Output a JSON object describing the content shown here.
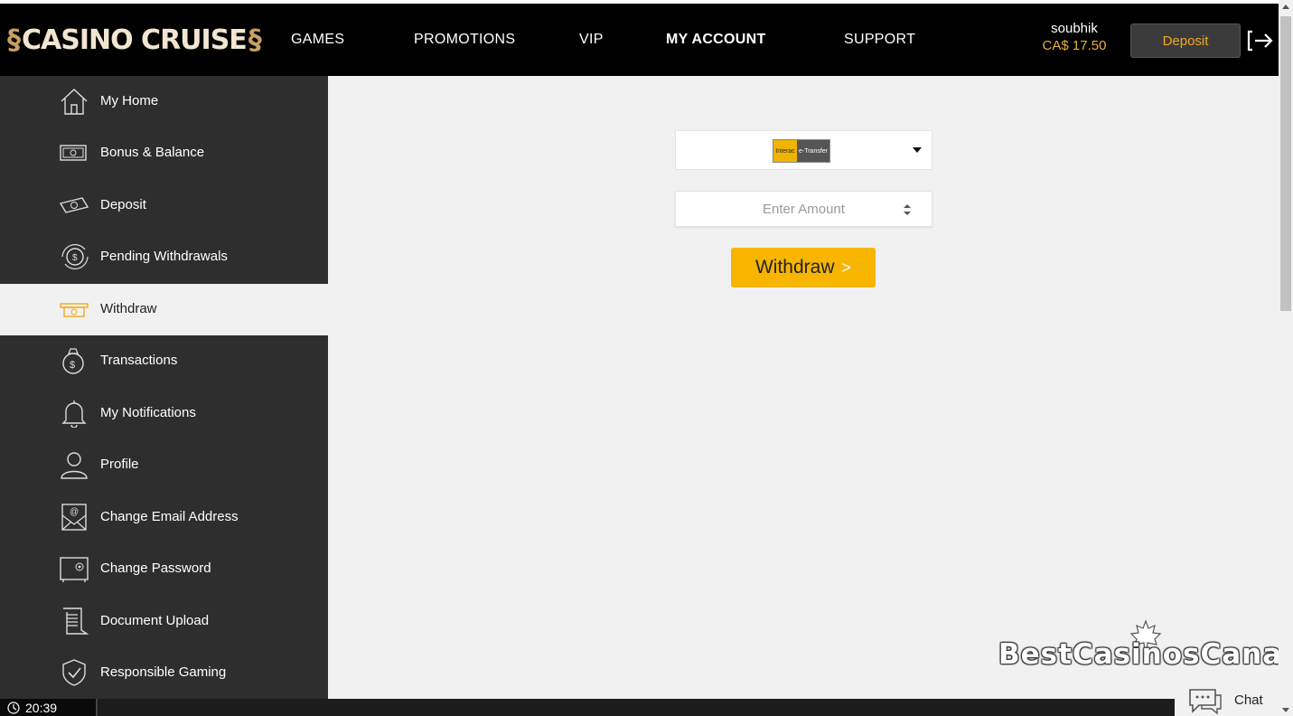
{
  "brand": {
    "logo_text": "CASINO CRUISE"
  },
  "nav": [
    {
      "label": "GAMES"
    },
    {
      "label": "PROMOTIONS"
    },
    {
      "label": "VIP"
    },
    {
      "label": "MY ACCOUNT"
    },
    {
      "label": "SUPPORT"
    }
  ],
  "user": {
    "name": "soubhik",
    "balance": "CA$ 17.50"
  },
  "header": {
    "deposit_label": "Deposit"
  },
  "sidebar": {
    "items": [
      {
        "label": "My Home",
        "icon": "home-icon"
      },
      {
        "label": "Bonus & Balance",
        "icon": "wallet-icon"
      },
      {
        "label": "Deposit",
        "icon": "cash-icon"
      },
      {
        "label": "Pending Withdrawals",
        "icon": "pending-coin-icon"
      },
      {
        "label": "Withdraw",
        "icon": "withdraw-icon"
      },
      {
        "label": "Transactions",
        "icon": "money-bag-icon"
      },
      {
        "label": "My Notifications",
        "icon": "bell-icon"
      },
      {
        "label": "Profile",
        "icon": "user-icon"
      },
      {
        "label": "Change Email Address",
        "icon": "envelope-icon"
      },
      {
        "label": "Change Password",
        "icon": "safe-icon"
      },
      {
        "label": "Document Upload",
        "icon": "document-icon"
      },
      {
        "label": "Responsible Gaming",
        "icon": "shield-check-icon"
      }
    ],
    "active": "Withdraw"
  },
  "withdraw_form": {
    "method_left": "Interac",
    "method_right": "e-Transfer",
    "amount_placeholder": "Enter Amount",
    "submit_label": "Withdraw",
    "submit_arrow": ">"
  },
  "watermark": {
    "text": "BestCasinosCanada"
  },
  "chat": {
    "label": "Chat"
  },
  "taskbar": {
    "time": "20:39"
  },
  "colors": {
    "accent": "#f7b500",
    "sidebar_bg": "#2e2e2e",
    "header_bg": "#000000",
    "balance": "#e8b13a"
  }
}
